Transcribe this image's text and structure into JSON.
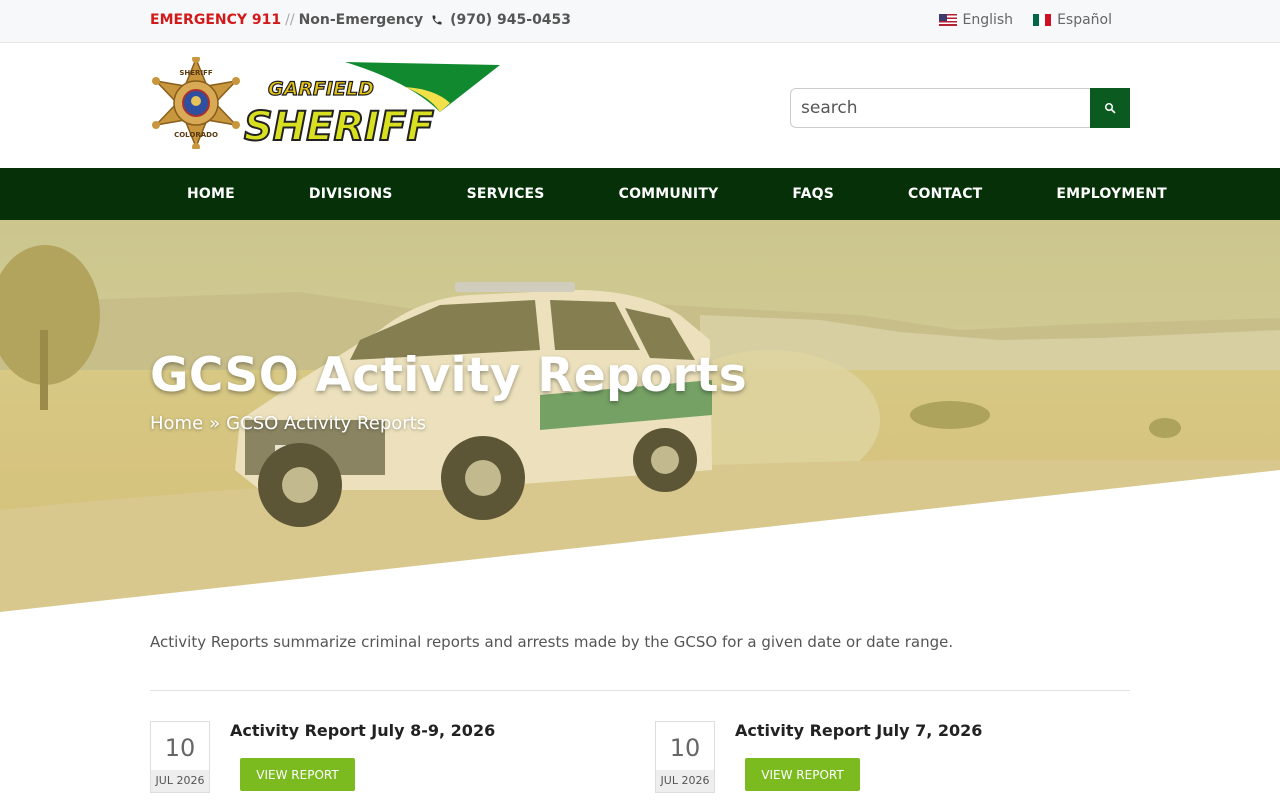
{
  "topbar": {
    "emergency": "EMERGENCY 911",
    "separator": "//",
    "non_emergency": "Non-Emergency",
    "phone": "(970) 945-0453",
    "languages": [
      "English",
      "Español"
    ]
  },
  "logo": {
    "badge_top": "SHERIFF",
    "badge_bottom": "COLORADO",
    "word1": "GARFIELD",
    "word2": "SHERIFF"
  },
  "search": {
    "placeholder": "search"
  },
  "nav": [
    "HOME",
    "DIVISIONS",
    "SERVICES",
    "COMMUNITY",
    "FAQS",
    "CONTACT",
    "EMPLOYMENT"
  ],
  "hero": {
    "title": "GCSO Activity Reports",
    "breadcrumb": {
      "home": "Home",
      "separator": "»",
      "current": "GCSO Activity Reports"
    }
  },
  "intro": "Activity Reports summarize criminal reports and arrests made by the GCSO for a given date or date range.",
  "posts": [
    {
      "day": "10",
      "month": "JUL 2026",
      "title": "Activity Report July 8-9, 2026",
      "button": "VIEW REPORT"
    },
    {
      "day": "10",
      "month": "JUL 2026",
      "title": "Activity Report July 7, 2026",
      "button": "VIEW REPORT"
    }
  ],
  "colors": {
    "nav_bg": "#053008",
    "search_btn": "#0b5a1f",
    "button_green": "#7cbb1f",
    "emergency_red": "#d21a1a"
  }
}
